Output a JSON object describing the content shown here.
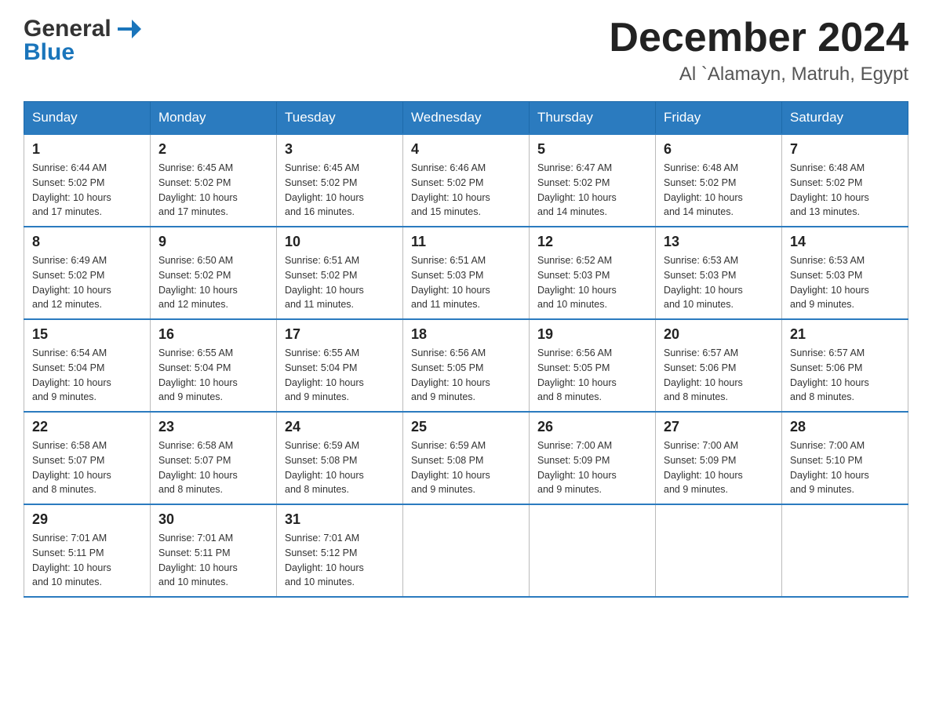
{
  "header": {
    "logo_general": "General",
    "logo_blue": "Blue",
    "month_year": "December 2024",
    "location": "Al `Alamayn, Matruh, Egypt"
  },
  "weekdays": [
    "Sunday",
    "Monday",
    "Tuesday",
    "Wednesday",
    "Thursday",
    "Friday",
    "Saturday"
  ],
  "weeks": [
    [
      {
        "day": "1",
        "sunrise": "6:44 AM",
        "sunset": "5:02 PM",
        "daylight": "10 hours and 17 minutes."
      },
      {
        "day": "2",
        "sunrise": "6:45 AM",
        "sunset": "5:02 PM",
        "daylight": "10 hours and 17 minutes."
      },
      {
        "day": "3",
        "sunrise": "6:45 AM",
        "sunset": "5:02 PM",
        "daylight": "10 hours and 16 minutes."
      },
      {
        "day": "4",
        "sunrise": "6:46 AM",
        "sunset": "5:02 PM",
        "daylight": "10 hours and 15 minutes."
      },
      {
        "day": "5",
        "sunrise": "6:47 AM",
        "sunset": "5:02 PM",
        "daylight": "10 hours and 14 minutes."
      },
      {
        "day": "6",
        "sunrise": "6:48 AM",
        "sunset": "5:02 PM",
        "daylight": "10 hours and 14 minutes."
      },
      {
        "day": "7",
        "sunrise": "6:48 AM",
        "sunset": "5:02 PM",
        "daylight": "10 hours and 13 minutes."
      }
    ],
    [
      {
        "day": "8",
        "sunrise": "6:49 AM",
        "sunset": "5:02 PM",
        "daylight": "10 hours and 12 minutes."
      },
      {
        "day": "9",
        "sunrise": "6:50 AM",
        "sunset": "5:02 PM",
        "daylight": "10 hours and 12 minutes."
      },
      {
        "day": "10",
        "sunrise": "6:51 AM",
        "sunset": "5:02 PM",
        "daylight": "10 hours and 11 minutes."
      },
      {
        "day": "11",
        "sunrise": "6:51 AM",
        "sunset": "5:03 PM",
        "daylight": "10 hours and 11 minutes."
      },
      {
        "day": "12",
        "sunrise": "6:52 AM",
        "sunset": "5:03 PM",
        "daylight": "10 hours and 10 minutes."
      },
      {
        "day": "13",
        "sunrise": "6:53 AM",
        "sunset": "5:03 PM",
        "daylight": "10 hours and 10 minutes."
      },
      {
        "day": "14",
        "sunrise": "6:53 AM",
        "sunset": "5:03 PM",
        "daylight": "10 hours and 9 minutes."
      }
    ],
    [
      {
        "day": "15",
        "sunrise": "6:54 AM",
        "sunset": "5:04 PM",
        "daylight": "10 hours and 9 minutes."
      },
      {
        "day": "16",
        "sunrise": "6:55 AM",
        "sunset": "5:04 PM",
        "daylight": "10 hours and 9 minutes."
      },
      {
        "day": "17",
        "sunrise": "6:55 AM",
        "sunset": "5:04 PM",
        "daylight": "10 hours and 9 minutes."
      },
      {
        "day": "18",
        "sunrise": "6:56 AM",
        "sunset": "5:05 PM",
        "daylight": "10 hours and 9 minutes."
      },
      {
        "day": "19",
        "sunrise": "6:56 AM",
        "sunset": "5:05 PM",
        "daylight": "10 hours and 8 minutes."
      },
      {
        "day": "20",
        "sunrise": "6:57 AM",
        "sunset": "5:06 PM",
        "daylight": "10 hours and 8 minutes."
      },
      {
        "day": "21",
        "sunrise": "6:57 AM",
        "sunset": "5:06 PM",
        "daylight": "10 hours and 8 minutes."
      }
    ],
    [
      {
        "day": "22",
        "sunrise": "6:58 AM",
        "sunset": "5:07 PM",
        "daylight": "10 hours and 8 minutes."
      },
      {
        "day": "23",
        "sunrise": "6:58 AM",
        "sunset": "5:07 PM",
        "daylight": "10 hours and 8 minutes."
      },
      {
        "day": "24",
        "sunrise": "6:59 AM",
        "sunset": "5:08 PM",
        "daylight": "10 hours and 8 minutes."
      },
      {
        "day": "25",
        "sunrise": "6:59 AM",
        "sunset": "5:08 PM",
        "daylight": "10 hours and 9 minutes."
      },
      {
        "day": "26",
        "sunrise": "7:00 AM",
        "sunset": "5:09 PM",
        "daylight": "10 hours and 9 minutes."
      },
      {
        "day": "27",
        "sunrise": "7:00 AM",
        "sunset": "5:09 PM",
        "daylight": "10 hours and 9 minutes."
      },
      {
        "day": "28",
        "sunrise": "7:00 AM",
        "sunset": "5:10 PM",
        "daylight": "10 hours and 9 minutes."
      }
    ],
    [
      {
        "day": "29",
        "sunrise": "7:01 AM",
        "sunset": "5:11 PM",
        "daylight": "10 hours and 10 minutes."
      },
      {
        "day": "30",
        "sunrise": "7:01 AM",
        "sunset": "5:11 PM",
        "daylight": "10 hours and 10 minutes."
      },
      {
        "day": "31",
        "sunrise": "7:01 AM",
        "sunset": "5:12 PM",
        "daylight": "10 hours and 10 minutes."
      },
      null,
      null,
      null,
      null
    ]
  ],
  "labels": {
    "sunrise": "Sunrise:",
    "sunset": "Sunset:",
    "daylight": "Daylight:"
  }
}
